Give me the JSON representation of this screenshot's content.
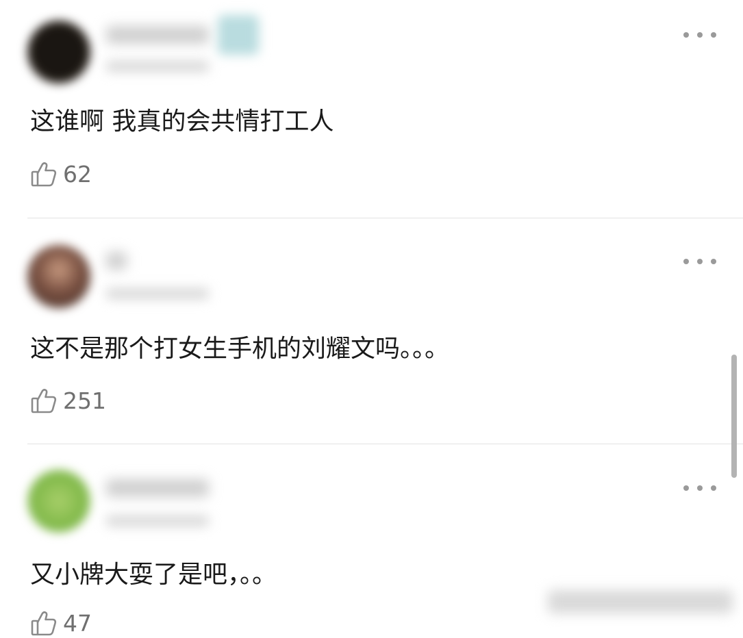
{
  "comments": [
    {
      "text": "这谁啊 我真的会共情打工人",
      "likes": "62"
    },
    {
      "text": "这不是那个打女生手机的刘耀文吗。。。",
      "likes": "251"
    },
    {
      "text": "又小牌大耍了是吧，。。",
      "likes": "47"
    }
  ],
  "icons": {
    "like": "thumbs-up-icon",
    "more": "more-icon"
  },
  "colors": {
    "like_count": "#6f6f6f",
    "divider": "#e3e3e3",
    "icon": "#8a8a8a"
  }
}
